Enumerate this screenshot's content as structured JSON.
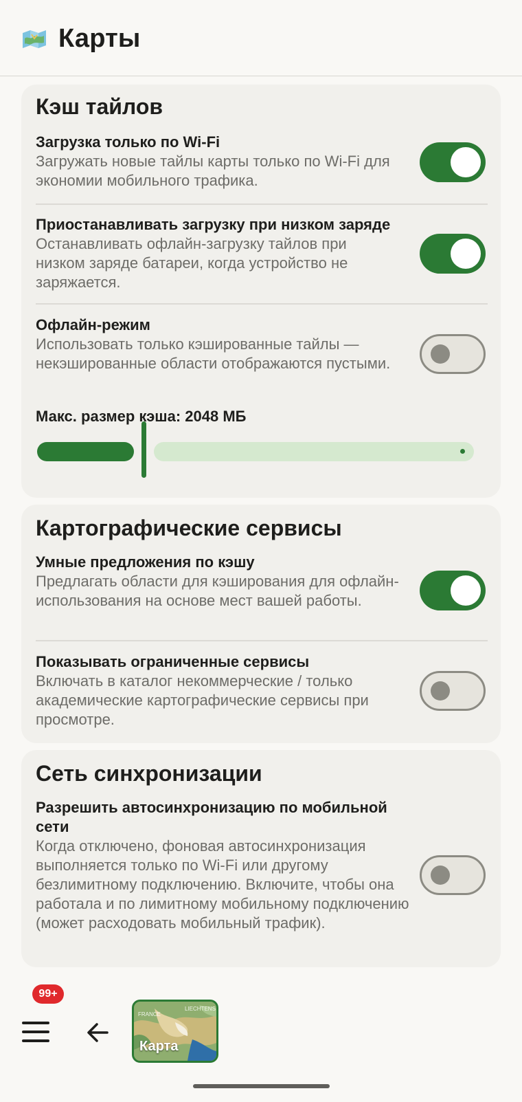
{
  "header": {
    "title": "Карты",
    "icon": "map-icon"
  },
  "colors": {
    "accent": "#2b7a34",
    "accent_light": "#d5e9cf",
    "background": "#f9f8f5",
    "card": "#f1f0ec",
    "badge": "#e0292c"
  },
  "sections": {
    "tile_cache": {
      "title": "Кэш тайлов",
      "wifi_only": {
        "title": "Загрузка только по Wi-Fi",
        "desc": "Загружать новые тайлы карты только по Wi-Fi для экономии мобильного трафика.",
        "enabled": true
      },
      "low_battery": {
        "title": "Приостанавливать загрузку при низком заряде",
        "desc": "Останавливать офлайн-загрузку тайлов при низком заряде батареи, когда устройство не заряжается.",
        "enabled": true
      },
      "offline_mode": {
        "title": "Офлайн-режим",
        "desc": "Использовать только кэшированные тайлы — некэшированные области отображаются пустыми.",
        "enabled": false
      },
      "cache_size": {
        "label": "Макс. размер кэша: 2048 МБ",
        "fraction": 0.23
      }
    },
    "map_services": {
      "title": "Картографические сервисы",
      "smart_suggestions": {
        "title": "Умные предложения по кэшу",
        "desc": "Предлагать области для кэширования для офлайн-использования на основе мест вашей работы.",
        "enabled": true
      },
      "restricted_services": {
        "title": "Показывать ограниченные сервисы",
        "desc": "Включать в каталог некоммерческие / только академические картографические сервисы при просмотре.",
        "enabled": false
      }
    },
    "sync_network": {
      "title": "Сеть синхронизации",
      "mobile_autosync": {
        "title": "Разрешить автосинхронизацию по мобильной сети",
        "desc": "Когда отключено, фоновая автосинхронизация выполняется только по Wi-Fi или другому безлимитному подключению. Включите, чтобы она работала и по лимитному мобильному подключению (может расходовать мобильный трафик).",
        "enabled": false
      }
    }
  },
  "bottom_bar": {
    "badge": "99+",
    "menu_icon": "hamburger-menu-icon",
    "back_icon": "arrow-left-icon",
    "map_thumb": {
      "label": "Карта",
      "mini_labels": [
        "FRANCE",
        "LIECHTENS"
      ]
    }
  }
}
